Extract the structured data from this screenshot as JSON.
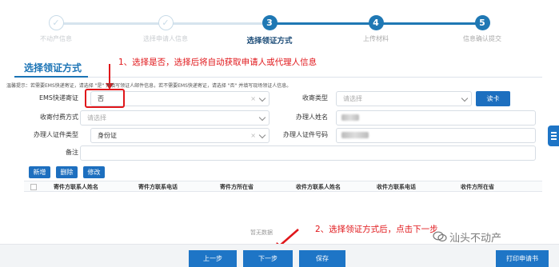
{
  "steps": [
    {
      "num": "✓",
      "label": "不动产信息",
      "state": "done"
    },
    {
      "num": "✓",
      "label": "选择申请人信息",
      "state": "done"
    },
    {
      "num": "3",
      "label": "选择领证方式",
      "state": "active"
    },
    {
      "num": "4",
      "label": "上传材料",
      "state": "todo"
    },
    {
      "num": "5",
      "label": "信息确认提交",
      "state": "todo"
    }
  ],
  "section": {
    "title": "选择领证方式",
    "hint": "温馨提示：若需要EMS快递寄证，请选择 \"是\" 并填写领证人邮件信息，若不需要EMS快递寄证，请选择 \"否\" 并填写现场领证人信息。"
  },
  "annotations": {
    "note1": "1、选择是否，选择后将自动获取申请人或代理人信息",
    "note2": "2、选择领证方式后，点击下一步"
  },
  "form": {
    "ems_label": "EMS快递寄证",
    "ems_value": "否",
    "ems_clear": "×",
    "mail_type_label": "收寄类型",
    "mail_type_placeholder": "请选择",
    "read_card": "读卡",
    "pay_label": "收寄付费方式",
    "pay_placeholder": "请选择",
    "agent_name_label": "办理人姓名",
    "agent_id_type_label": "办理人证件类型",
    "agent_id_type_value": "身份证",
    "agent_id_type_clear": "×",
    "agent_id_no_label": "办理人证件号码",
    "remark_label": "备注"
  },
  "toolbar": {
    "add": "新增",
    "delete": "删除",
    "edit": "修改"
  },
  "table": {
    "columns": [
      "寄件方联系人姓名",
      "寄件方联系电话",
      "寄件方所在省",
      "收件方联系人姓名",
      "收件方联系电话",
      "收件方所在省"
    ],
    "empty": "暂无数据"
  },
  "bottom": {
    "prev": "上一步",
    "next": "下一步",
    "save": "保存",
    "print": "打印申请书"
  },
  "watermark": "汕头不动产",
  "colors": {
    "accent": "#1e75c6",
    "annotation_red": "#e0161a"
  }
}
